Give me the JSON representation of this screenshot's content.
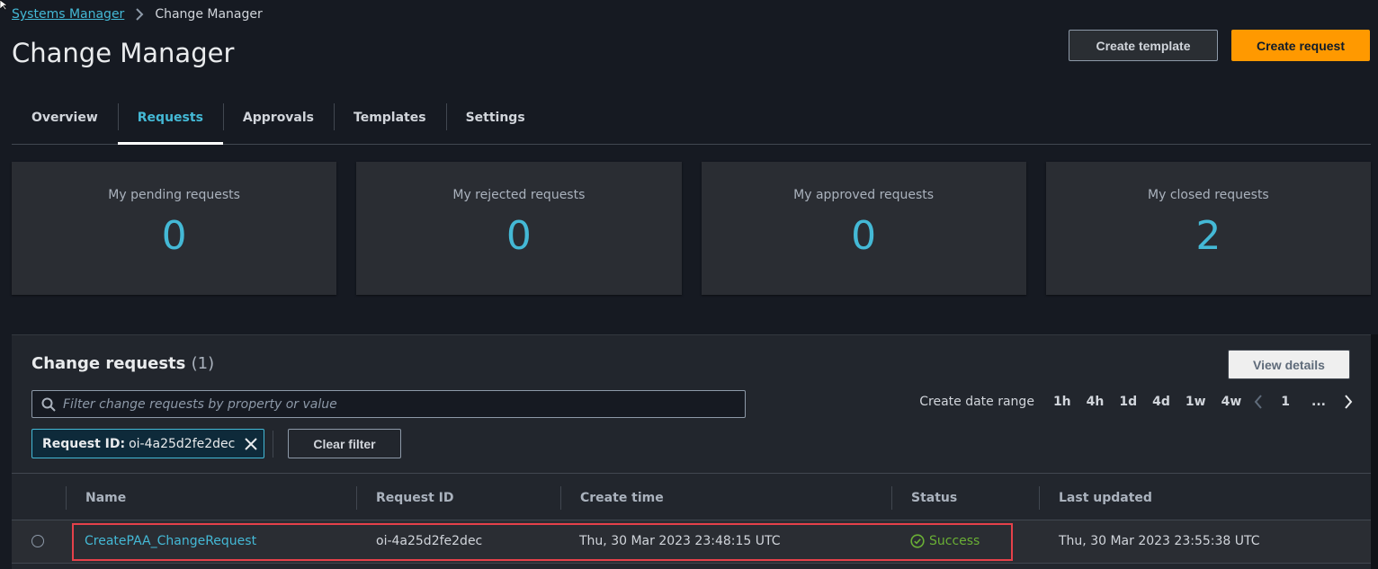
{
  "breadcrumb": {
    "items": [
      {
        "label": "Systems Manager"
      },
      {
        "label": "Change Manager"
      }
    ]
  },
  "header": {
    "title": "Change Manager",
    "create_template_label": "Create template",
    "create_request_label": "Create request"
  },
  "tabs": [
    {
      "label": "Overview",
      "active": false
    },
    {
      "label": "Requests",
      "active": true
    },
    {
      "label": "Approvals",
      "active": false
    },
    {
      "label": "Templates",
      "active": false
    },
    {
      "label": "Settings",
      "active": false
    }
  ],
  "summary_cards": [
    {
      "label": "My pending requests",
      "value": "0"
    },
    {
      "label": "My rejected requests",
      "value": "0"
    },
    {
      "label": "My approved requests",
      "value": "0"
    },
    {
      "label": "My closed requests",
      "value": "2"
    }
  ],
  "change_requests": {
    "title": "Change requests",
    "count": "(1)",
    "view_details_label": "View details",
    "search": {
      "placeholder": "Filter change requests by property or value",
      "value": ""
    },
    "filter_token": {
      "key": "Request ID:",
      "value": "oi-4a25d2fe2dec"
    },
    "clear_filter_label": "Clear filter",
    "date_range": {
      "label": "Create date range",
      "options": [
        "1h",
        "4h",
        "1d",
        "4d",
        "1w",
        "4w"
      ]
    },
    "pagination": {
      "current_page": "1",
      "ellipsis": "..."
    },
    "columns": [
      "Name",
      "Request ID",
      "Create time",
      "Status",
      "Last updated"
    ],
    "rows": [
      {
        "name": "CreatePAA_ChangeRequest",
        "request_id": "oi-4a25d2fe2dec",
        "create_time": "Thu, 30 Mar 2023 23:48:15 UTC",
        "status": "Success",
        "last_updated": "Thu, 30 Mar 2023 23:55:38 UTC"
      }
    ]
  },
  "colors": {
    "accent": "#44b9d6",
    "primary_button": "#ff9900",
    "success": "#6aaf35",
    "highlight_box": "#e5414a"
  }
}
